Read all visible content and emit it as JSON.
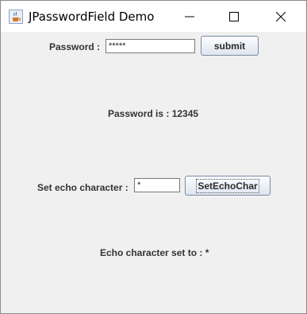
{
  "window": {
    "title": "JPasswordField Demo"
  },
  "password_row": {
    "label": "Password :",
    "value": "*****",
    "submit_label": "submit"
  },
  "password_result": "Password is : 12345",
  "echo_row": {
    "label": "Set echo character :",
    "value": "*",
    "button_label": "SetEchoChar"
  },
  "echo_result": "Echo character set to : *",
  "icons": {
    "app": "java-cup-icon",
    "minimize": "minimize-icon",
    "maximize": "maximize-icon",
    "close": "close-icon"
  },
  "colors": {
    "window_bg": "#f0f0f0",
    "titlebar_bg": "#ffffff",
    "label_text": "#333333",
    "button_border": "#7a8aa6"
  }
}
